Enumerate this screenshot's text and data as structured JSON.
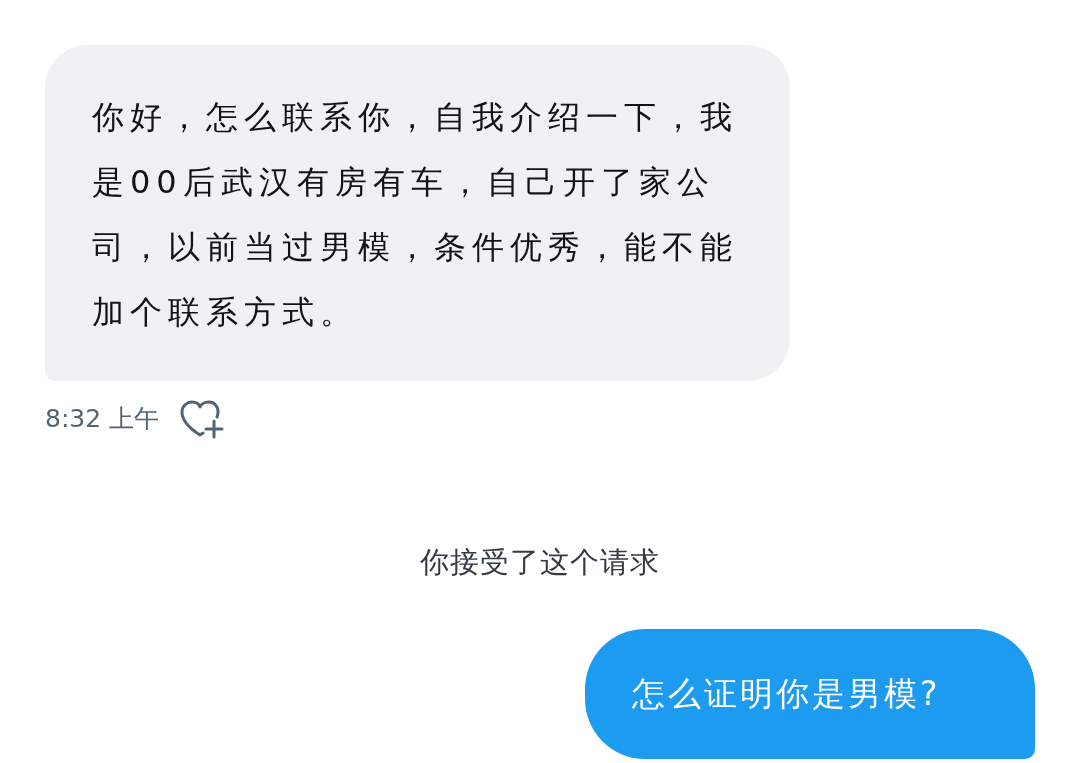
{
  "messages": [
    {
      "kind": "incoming",
      "text": "你好，怎么联系你，自我介绍一下，我是00后武汉有房有车，自己开了家公司，以前当过男模，条件优秀，能不能加个联系方式。",
      "time": "8:32 上午"
    },
    {
      "kind": "system",
      "text": "你接受了这个请求"
    },
    {
      "kind": "outgoing",
      "text": "怎么证明你是男模?"
    }
  ]
}
